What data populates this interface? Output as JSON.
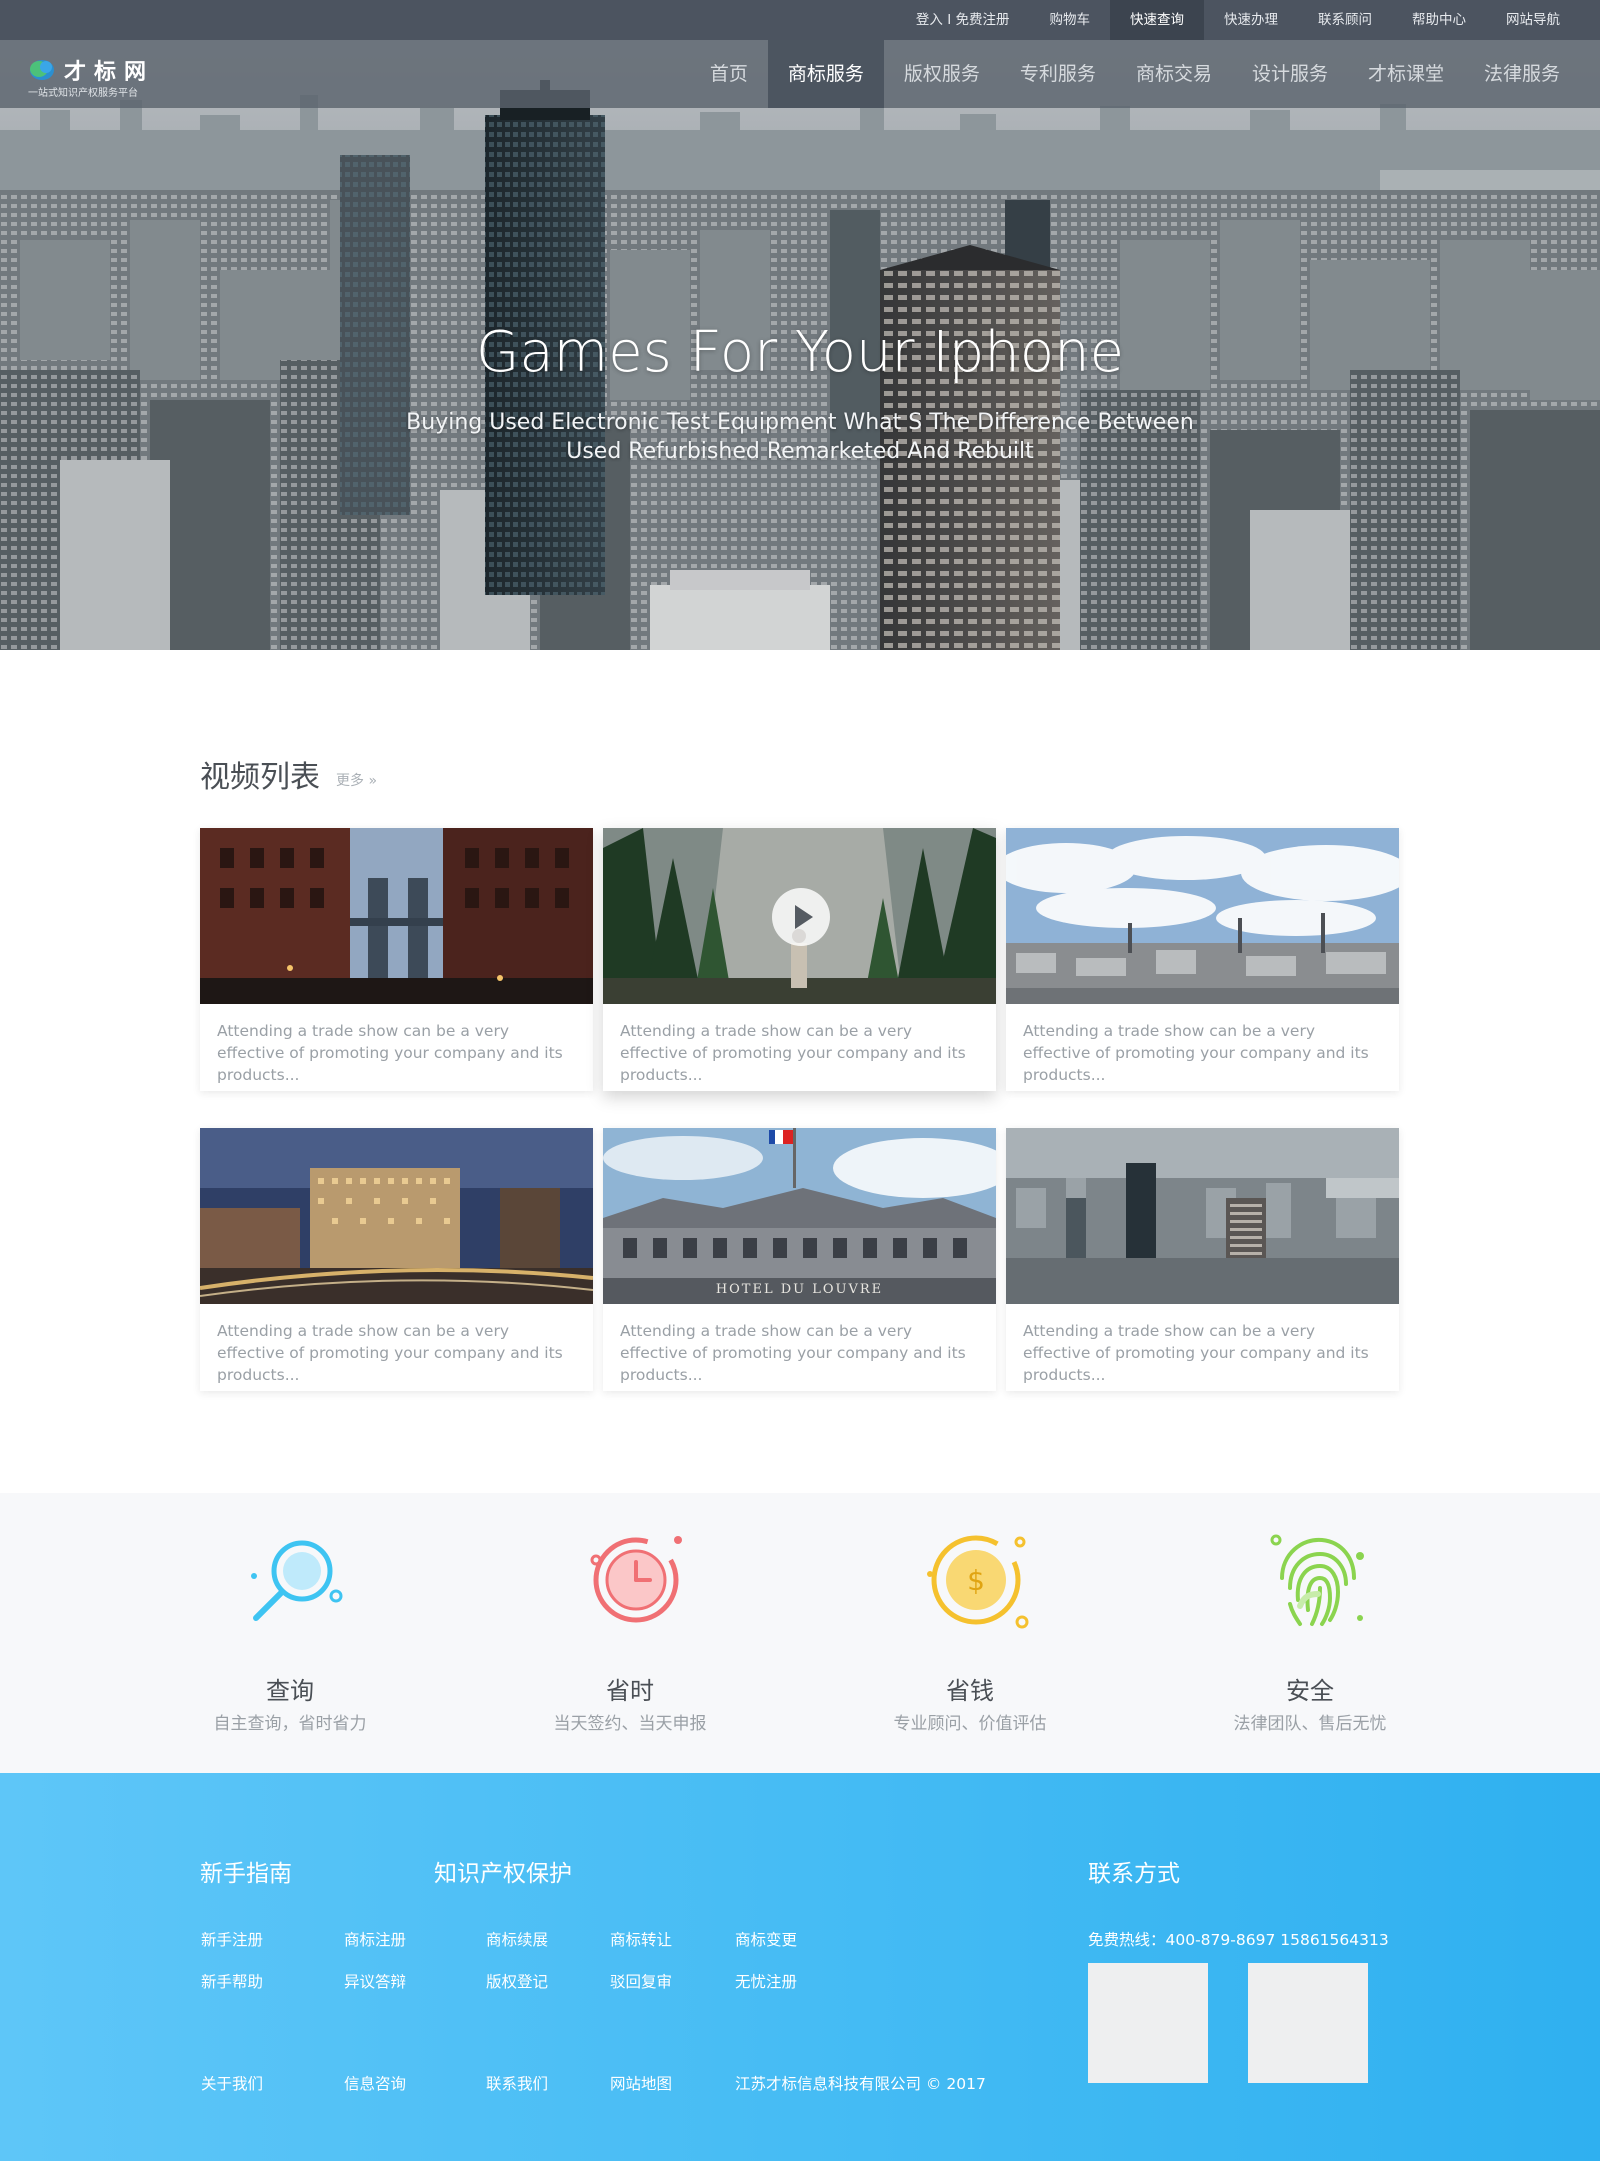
{
  "topbar": {
    "links": [
      "登入 I 免费注册",
      "购物车",
      "快速查询",
      "快速办理",
      "联系顾问",
      "帮助中心",
      "网站导航"
    ],
    "active_index": 2
  },
  "logo": {
    "name": "才标网",
    "tagline": "一站式知识产权服务平台"
  },
  "nav": {
    "items": [
      "首页",
      "商标服务",
      "版权服务",
      "专利服务",
      "商标交易",
      "设计服务",
      "才标课堂",
      "法律服务"
    ],
    "active_index": 1
  },
  "hero": {
    "title": "Games For Your Iphone",
    "subtitle_line1": "Buying Used Electronic Test Equipment What S The Difference Between",
    "subtitle_line2": "Used Refurbished Remarketed And Rebuilt"
  },
  "videos": {
    "title": "视频列表",
    "more": "更多 »",
    "items": [
      {
        "desc": "Attending a trade show can be a very effective of promoting your company and its products...",
        "scene": "bridge-street"
      },
      {
        "desc": "Attending a trade show can be a very effective of promoting your company and its products...",
        "scene": "forest-hiker",
        "playing": true
      },
      {
        "desc": "Attending a trade show can be a very effective of promoting your company and its products...",
        "scene": "cloudy-city"
      },
      {
        "desc": "Attending a trade show can be a very effective of promoting your company and its products...",
        "scene": "night-street"
      },
      {
        "desc": "Attending a trade show can be a very effective of promoting your company and its products...",
        "scene": "hotel-du-louvre",
        "sign": "HOTEL DU LOUVRE"
      },
      {
        "desc": "Attending a trade show can be a very effective of promoting your company and its products...",
        "scene": "city-skyline"
      }
    ]
  },
  "features": [
    {
      "title": "查询",
      "sub": "自主查询，省时省力",
      "icon": "magnifier-icon",
      "color": "#3ec4f2"
    },
    {
      "title": "省时",
      "sub": "当天签约、当天申报",
      "icon": "clock-icon",
      "color": "#f07074"
    },
    {
      "title": "省钱",
      "sub": "专业顾问、价值评估",
      "icon": "coin-icon",
      "color": "#f5c12e"
    },
    {
      "title": "安全",
      "sub": "法律团队、售后无忧",
      "icon": "fingerprint-icon",
      "color": "#8bd44f"
    }
  ],
  "footer": {
    "guide_title": "新手指南",
    "ip_title": "知识产权保护",
    "contact_title": "联系方式",
    "guide_links": [
      "新手注册",
      "新手帮助"
    ],
    "ip_links_row1": [
      "商标注册",
      "商标续展",
      "商标转让",
      "商标变更"
    ],
    "ip_links_row2": [
      "异议答辩",
      "版权登记",
      "驳回复审",
      "无忧注册"
    ],
    "hotline": "免费热线：400-879-8697     15861564313",
    "bottom_links": [
      "关于我们",
      "信息咨询",
      "联系我们",
      "网站地图"
    ],
    "copyright": "江苏才标信息科技有限公司 © 2017"
  }
}
